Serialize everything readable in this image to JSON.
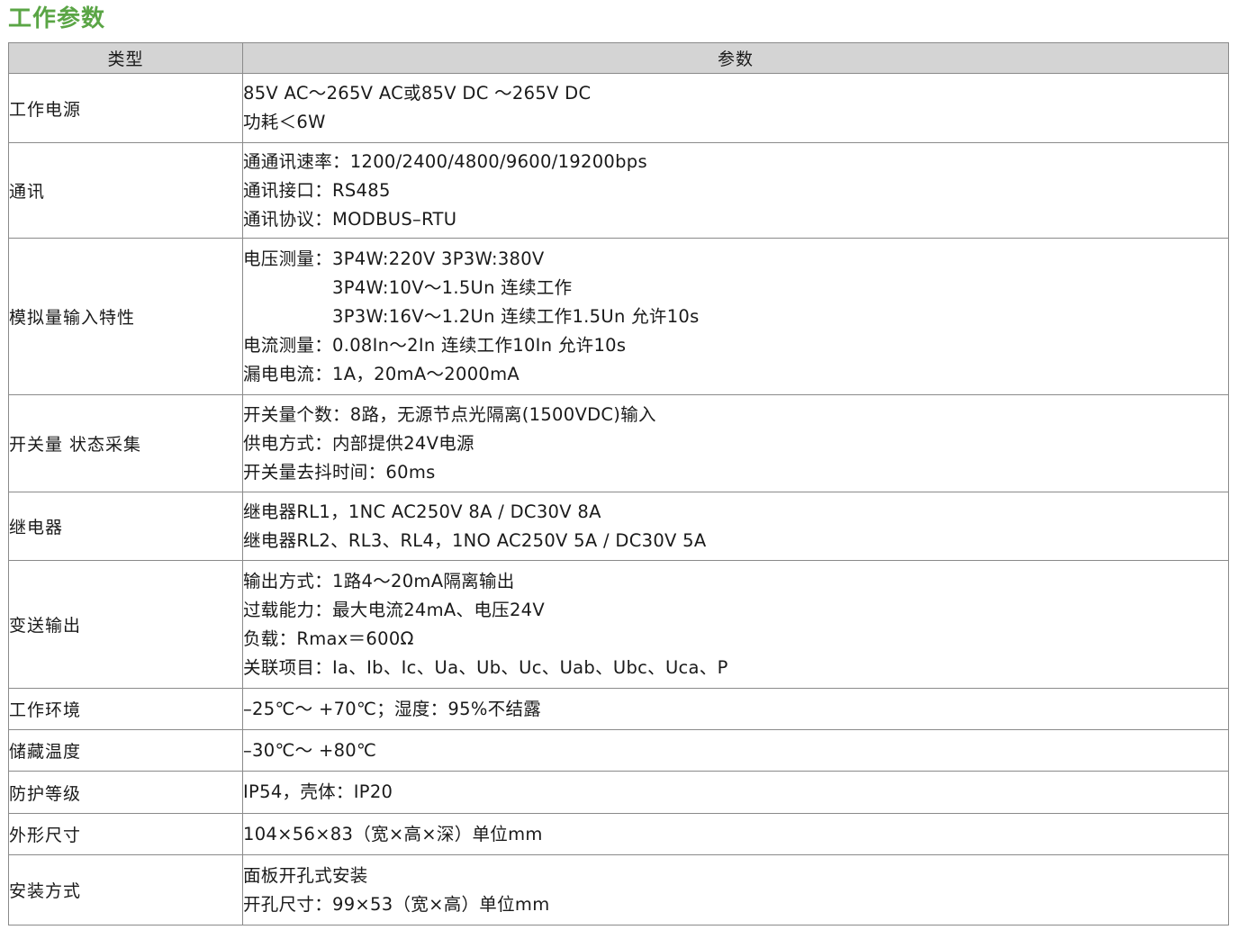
{
  "title": "工作参数",
  "table": {
    "headers": [
      "类型",
      "参数"
    ],
    "rows": [
      {
        "type": "工作电源",
        "lines": [
          "85V AC～265V AC或85V DC ～265V DC",
          "功耗＜6W"
        ]
      },
      {
        "type": "通讯",
        "lines": [
          "通通讯速率：1200/2400/4800/9600/19200bps",
          "通讯接口：RS485",
          "通讯协议：MODBUS–RTU"
        ]
      },
      {
        "type": "模拟量输入特性",
        "lines": [
          "电压测量：3P4W:220V 3P3W:380V",
          "　　　　　3P4W:10V～1.5Un 连续工作",
          "　　　　　3P3W:16V～1.2Un 连续工作1.5Un 允许10s",
          "电流测量：0.08In～2In 连续工作10In 允许10s",
          "漏电电流：1A，20mA～2000mA"
        ]
      },
      {
        "type": "开关量 状态采集",
        "lines": [
          "开关量个数：8路，无源节点光隔离(1500VDC)输入",
          "供电方式：内部提供24V电源",
          "开关量去抖时间：60ms"
        ]
      },
      {
        "type": "继电器",
        "lines": [
          "继电器RL1，1NC AC250V 8A / DC30V 8A",
          "继电器RL2、RL3、RL4，1NO AC250V 5A / DC30V 5A"
        ]
      },
      {
        "type": "变送输出",
        "lines": [
          "输出方式：1路4～20mA隔离输出",
          "过载能力：最大电流24mA、电压24V",
          "负载：Rmax＝600Ω",
          "关联项目：Ia、Ib、Ic、Ua、Ub、Uc、Uab、Ubc、Uca、P"
        ]
      },
      {
        "type": "工作环境",
        "lines": [
          "–25℃～ +70℃；湿度：95%不结露"
        ]
      },
      {
        "type": "储藏温度",
        "lines": [
          "–30℃～ +80℃"
        ]
      },
      {
        "type": "防护等级",
        "lines": [
          "IP54，壳体：IP20"
        ]
      },
      {
        "type": "外形尺寸",
        "lines": [
          "104×56×83（宽×高×深）单位mm"
        ]
      },
      {
        "type": "安装方式",
        "lines": [
          "面板开孔式安装",
          "开孔尺寸：99×53（宽×高）单位mm"
        ]
      }
    ]
  }
}
